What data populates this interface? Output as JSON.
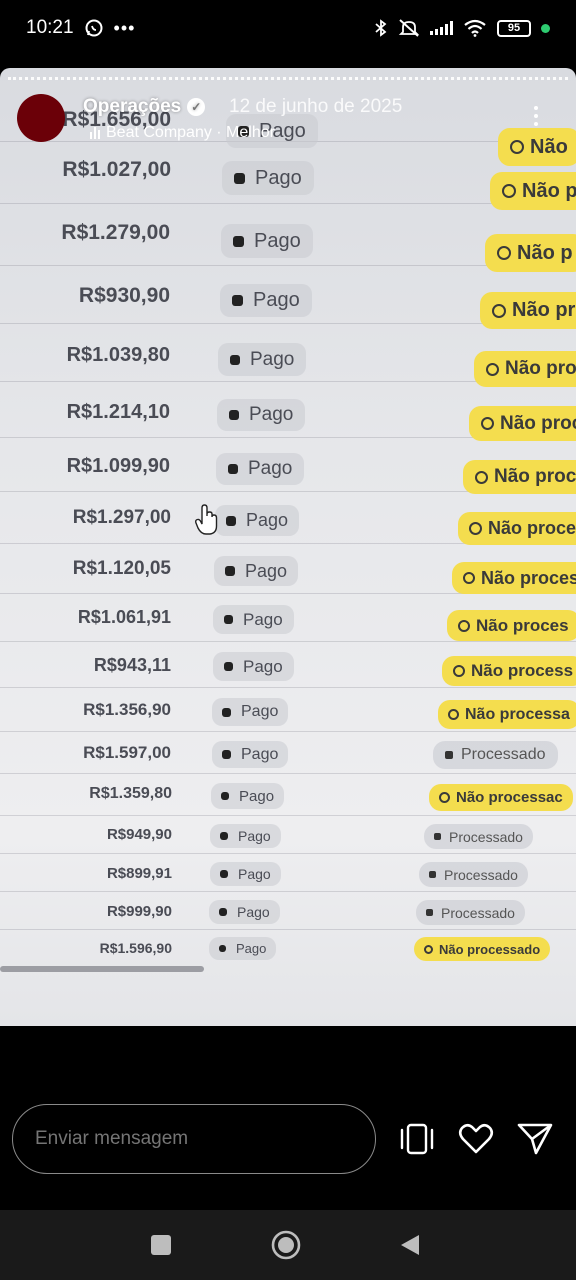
{
  "status_bar": {
    "time": "10:21",
    "left_icons": [
      "whatsapp-icon",
      "more-dots-icon"
    ],
    "right_icons": [
      "bluetooth-icon",
      "silent-icon",
      "signal-icon",
      "wifi-icon",
      "battery-icon",
      "active-dot"
    ],
    "battery": "95",
    "accent_color": "#2ecc71"
  },
  "story": {
    "username": "Operações",
    "date": "12 de junho de 2025",
    "music": "Beat Company · Melhor",
    "avatar_color": "#6b0008"
  },
  "table": {
    "partial_top": {
      "amount": "R$1.656,00",
      "payment": "Pago",
      "status": "Não"
    },
    "rows": [
      {
        "amount": "R$1.027,00",
        "payment": "Pago",
        "status": "Não p"
      },
      {
        "amount": "R$1.279,00",
        "payment": "Pago",
        "status": "Não p"
      },
      {
        "amount": "R$930,90",
        "payment": "Pago",
        "status": "Não pr"
      },
      {
        "amount": "R$1.039,80",
        "payment": "Pago",
        "status": "Não pro"
      },
      {
        "amount": "R$1.214,10",
        "payment": "Pago",
        "status": "Não proc"
      },
      {
        "amount": "R$1.099,90",
        "payment": "Pago",
        "status": "Não proc"
      },
      {
        "amount": "R$1.297,00",
        "payment": "Pago",
        "status": "Não proce"
      },
      {
        "amount": "R$1.120,05",
        "payment": "Pago",
        "status": "Não proces"
      },
      {
        "amount": "R$1.061,91",
        "payment": "Pago",
        "status": "Não proces"
      },
      {
        "amount": "R$943,11",
        "payment": "Pago",
        "status": "Não process"
      },
      {
        "amount": "R$1.356,90",
        "payment": "Pago",
        "status": "Não processa"
      },
      {
        "amount": "R$1.597,00",
        "payment": "Pago",
        "status": "Processado"
      },
      {
        "amount": "R$1.359,80",
        "payment": "Pago",
        "status": "Não processac"
      },
      {
        "amount": "R$949,90",
        "payment": "Pago",
        "status": "Processado"
      },
      {
        "amount": "R$899,91",
        "payment": "Pago",
        "status": "Processado"
      },
      {
        "amount": "R$999,90",
        "payment": "Pago",
        "status": "Processado"
      },
      {
        "amount": "R$1.596,90",
        "payment": "Pago",
        "status": "Não processado"
      }
    ],
    "status_colors": {
      "pending": "#f4dd4e",
      "processed": "#c8cad0"
    }
  },
  "reply": {
    "placeholder": "Enviar mensagem",
    "actions": [
      "share-story-icon",
      "heart-icon",
      "send-icon"
    ]
  },
  "nav": [
    "recents-icon",
    "home-icon",
    "back-icon"
  ]
}
